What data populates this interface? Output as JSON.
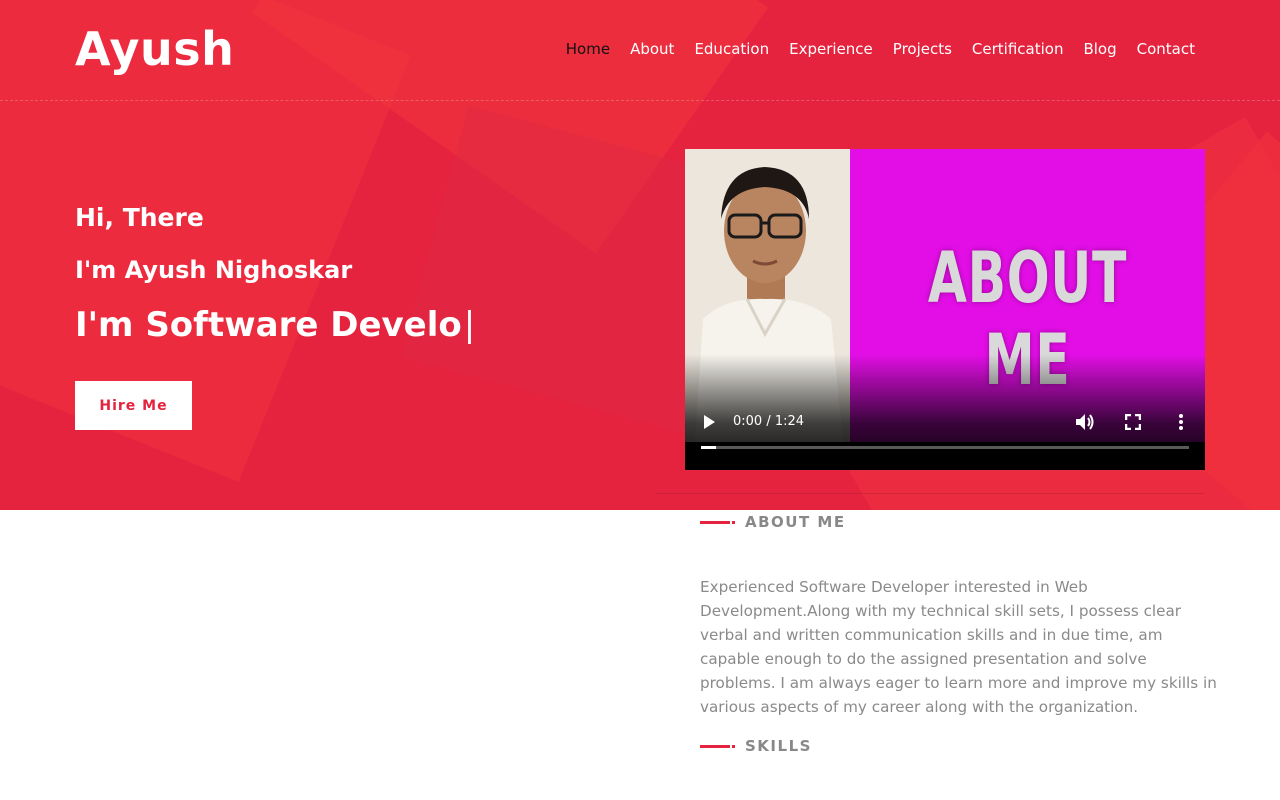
{
  "brand": {
    "name": "Ayush"
  },
  "nav": {
    "items": [
      {
        "label": "Home",
        "active": true
      },
      {
        "label": "About"
      },
      {
        "label": "Education"
      },
      {
        "label": "Experience"
      },
      {
        "label": "Projects"
      },
      {
        "label": "Certification"
      },
      {
        "label": "Blog"
      },
      {
        "label": "Contact"
      }
    ]
  },
  "hero": {
    "greeting": "Hi, There",
    "name_line": "I'm Ayush Nighoskar",
    "typing_text": "I'm Software Develo",
    "caret": "|",
    "hire_button": "Hire Me"
  },
  "video": {
    "title_overlay": "ABOUT ME",
    "time": "0:00 / 1:24",
    "progress": 0.03,
    "controls": [
      "play-icon",
      "volume-icon",
      "fullscreen-icon",
      "more-options-icon"
    ]
  },
  "about": {
    "heading": "ABOUT ME",
    "text": "Experienced Software Developer interested in Web Development.Along with my technical skill sets, I possess clear verbal and written communication skills and in due time, am capable enough to do the assigned presentation and solve problems. I am always eager to learn more and improve my skills in various aspects of my career along with the organization."
  },
  "skills": {
    "heading": "SKILLS"
  },
  "colors": {
    "accent": "#e5233f",
    "nav_active": "#111111",
    "video_panel": "#e30ee6",
    "muted_text": "#8a8a8a"
  }
}
